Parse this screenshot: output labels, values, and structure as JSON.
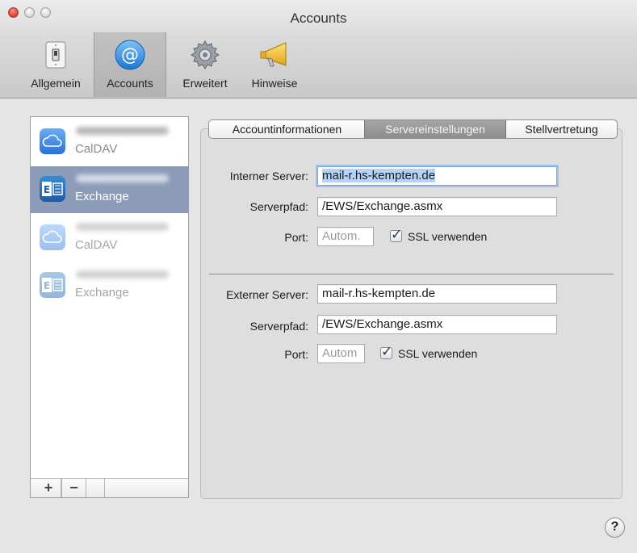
{
  "window": {
    "title": "Accounts"
  },
  "toolbar": {
    "items": [
      {
        "label": "Allgemein",
        "icon": "switch-icon"
      },
      {
        "label": "Accounts",
        "icon": "at-sign-icon"
      },
      {
        "label": "Erweitert",
        "icon": "gear-icon"
      },
      {
        "label": "Hinweise",
        "icon": "megaphone-icon"
      }
    ],
    "selected": "Accounts"
  },
  "accounts": [
    {
      "type": "CalDAV",
      "icon": "icloud-icon",
      "selected": false,
      "dimmed": false
    },
    {
      "type": "Exchange",
      "icon": "exchange-icon",
      "selected": true,
      "dimmed": false
    },
    {
      "type": "CalDAV",
      "icon": "icloud-icon",
      "selected": false,
      "dimmed": true
    },
    {
      "type": "Exchange",
      "icon": "exchange-icon",
      "selected": false,
      "dimmed": true
    }
  ],
  "list_buttons": {
    "add": "+",
    "remove": "−"
  },
  "tabs": [
    {
      "label": "Accountinformationen"
    },
    {
      "label": "Servereinstellungen"
    },
    {
      "label": "Stellvertretung"
    }
  ],
  "active_tab": "Servereinstellungen",
  "internal": {
    "server_label": "Interner Server:",
    "server_value": "mail-r.hs-kempten.de",
    "path_label": "Serverpfad:",
    "path_value": "/EWS/Exchange.asmx",
    "port_label": "Port:",
    "port_placeholder": "Autom.",
    "ssl_label": "SSL verwenden",
    "ssl_checked": true
  },
  "external": {
    "server_label": "Externer Server:",
    "server_value": "mail-r.hs-kempten.de",
    "path_label": "Serverpfad:",
    "path_value": "/EWS/Exchange.asmx",
    "port_label": "Port:",
    "port_placeholder": "Autom",
    "ssl_label": "SSL verwenden",
    "ssl_checked": true
  },
  "help": {
    "label": "?"
  },
  "colors": {
    "selection": "#8c9bb8",
    "focus_ring": "#9fc2ee",
    "text_selection": "#b3d3f7"
  }
}
